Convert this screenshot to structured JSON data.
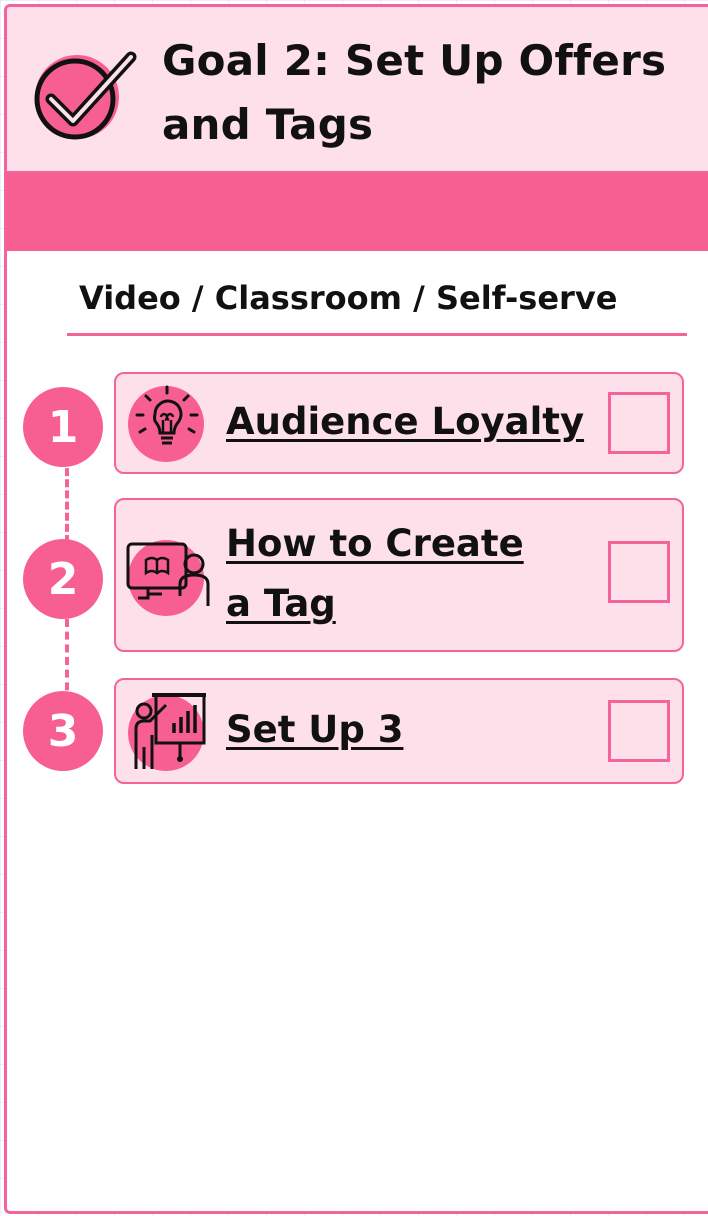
{
  "header": {
    "title_line1": "Goal 2: Set Up Offers",
    "title_line2": "and Tags",
    "icon": "check-circle-icon"
  },
  "subtitle": "Video / Classroom / Self-serve",
  "colors": {
    "accent": "#f75f93",
    "border": "#f4649a",
    "panel_bg": "#fde0ea",
    "text": "#111111"
  },
  "steps": [
    {
      "number": "1",
      "label": "Audience Loyalty",
      "icon": "lightbulb-icon",
      "checked": false
    },
    {
      "number": "2",
      "label_line1": "How to Create",
      "label_line2": "a Tag",
      "icon": "online-lesson-icon",
      "checked": false
    },
    {
      "number": "3",
      "label": "Set Up 3",
      "icon": "presenter-chart-icon",
      "checked": false
    }
  ]
}
